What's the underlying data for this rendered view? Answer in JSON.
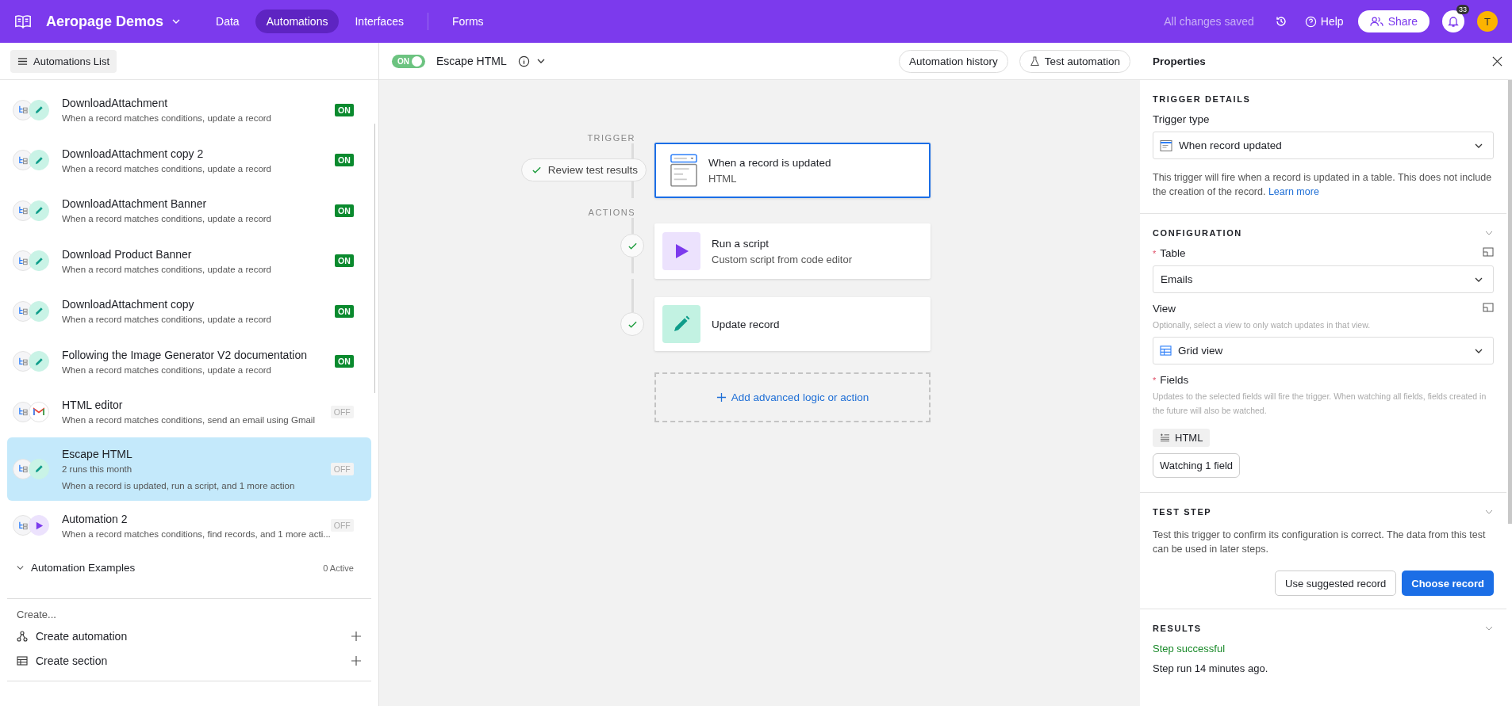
{
  "topbar": {
    "base_name": "Aeropage Demos",
    "nav": [
      {
        "label": "Data",
        "selected": false
      },
      {
        "label": "Automations",
        "selected": true
      },
      {
        "label": "Interfaces",
        "selected": false
      },
      {
        "label": "Forms",
        "selected": false
      }
    ],
    "save_status": "All changes saved",
    "help": "Help",
    "share": "Share",
    "notification_count": "33",
    "avatar_initial": "T"
  },
  "sidebar": {
    "list_button": "Automations List",
    "automations": [
      {
        "name": "DownloadAttachment",
        "description": "When a record matches conditions, update a record",
        "kind": "update",
        "on": true,
        "status": "ON",
        "selected": false
      },
      {
        "name": "DownloadAttachment copy 2",
        "description": "When a record matches conditions, update a record",
        "kind": "update",
        "on": true,
        "status": "ON",
        "selected": false
      },
      {
        "name": "DownloadAttachment Banner",
        "description": "When a record matches conditions, update a record",
        "kind": "update",
        "on": true,
        "status": "ON",
        "selected": false
      },
      {
        "name": "Download Product Banner",
        "description": "When a record matches conditions, update a record",
        "kind": "update",
        "on": true,
        "status": "ON",
        "selected": false
      },
      {
        "name": "DownloadAttachment copy",
        "description": "When a record matches conditions, update a record",
        "kind": "update",
        "on": true,
        "status": "ON",
        "selected": false
      },
      {
        "name": "Following the Image Generator V2 documentation",
        "description": "When a record matches conditions, update a record",
        "kind": "update",
        "on": true,
        "status": "ON",
        "selected": false
      },
      {
        "name": "HTML editor",
        "description": "When a record matches conditions, send an email using Gmail",
        "kind": "gmail",
        "on": false,
        "status": "OFF",
        "selected": false
      },
      {
        "name": "Escape HTML",
        "runs": "2 runs this month",
        "description": "When a record is updated, run a script, and 1 more action",
        "kind": "update",
        "on": false,
        "status": "OFF",
        "selected": true
      },
      {
        "name": "Automation 2",
        "description": "When a record matches conditions, find records, and 1 more acti...",
        "kind": "script",
        "on": false,
        "status": "OFF",
        "selected": false
      }
    ],
    "section": {
      "name": "Automation Examples",
      "active_count": "0 Active"
    },
    "create_heading": "Create...",
    "create_items": [
      {
        "label": "Create automation",
        "kind": "automation"
      },
      {
        "label": "Create section",
        "kind": "section"
      }
    ]
  },
  "toolbar": {
    "on": true,
    "toggle_label": "ON",
    "automation_name": "Escape HTML",
    "history_button": "Automation history",
    "test_button": "Test automation"
  },
  "canvas": {
    "trigger_label": "TRIGGER",
    "review_button": "Review test results",
    "trigger": {
      "title": "When a record is updated",
      "subtitle": "HTML",
      "selected": true
    },
    "actions_label": "ACTIONS",
    "actions": [
      {
        "kind": "script",
        "title": "Run a script",
        "subtitle": "Custom script from code editor",
        "tested": true
      },
      {
        "kind": "update",
        "title": "Update record",
        "tested": true
      }
    ],
    "add_button": "Add advanced logic or action"
  },
  "properties": {
    "title": "Properties",
    "trigger_details": {
      "heading": "TRIGGER DETAILS",
      "type_label": "Trigger type",
      "type_value": "When record updated",
      "description": "This trigger will fire when a record is updated in a table. This does not include the creation of the record.",
      "learn_more": "Learn more"
    },
    "configuration": {
      "heading": "CONFIGURATION",
      "table_marker": "*",
      "table_label": "Table",
      "table_value": "Emails",
      "view_label": "View",
      "view_hint": "Optionally, select a view to only watch updates in that view.",
      "view_value": "Grid view",
      "fields_marker": "*",
      "fields_label": "Fields",
      "fields_hint": "Updates to the selected fields will fire the trigger. When watching all fields, fields created in the future will also be watched.",
      "field_chips": [
        "HTML"
      ],
      "watching_button": "Watching 1 field"
    },
    "test_step": {
      "heading": "TEST STEP",
      "description": "Test this trigger to confirm its configuration is correct. The data from this test can be used in later steps.",
      "secondary_button": "Use suggested record",
      "primary_button": "Choose record"
    },
    "results": {
      "heading": "RESULTS",
      "status": "Step successful",
      "detail": "Step run 14 minutes ago."
    }
  }
}
